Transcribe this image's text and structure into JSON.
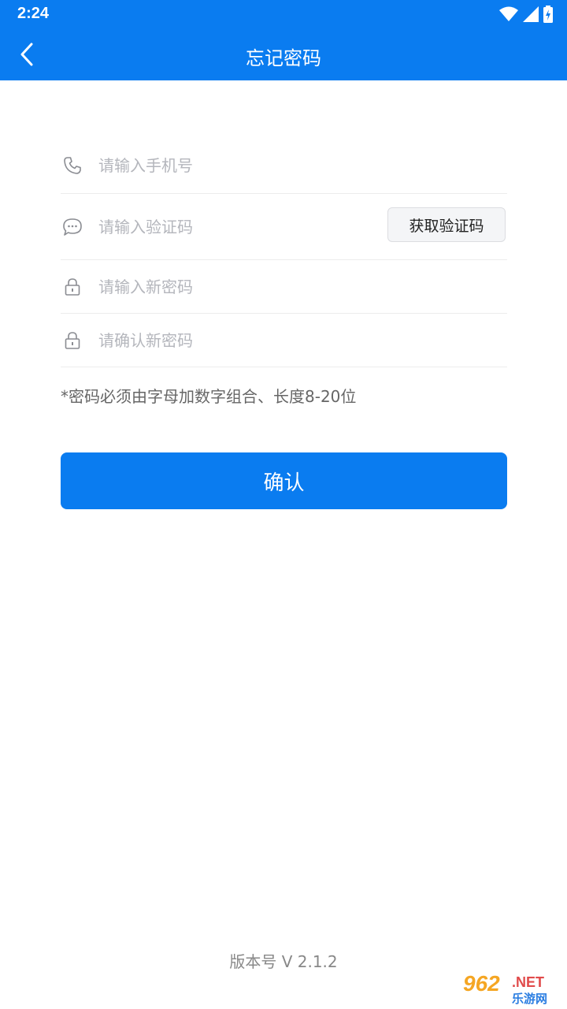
{
  "status_bar": {
    "time": "2:24"
  },
  "header": {
    "title": "忘记密码"
  },
  "form": {
    "phone_placeholder": "请输入手机号",
    "code_placeholder": "请输入验证码",
    "get_code_label": "获取验证码",
    "new_password_placeholder": "请输入新密码",
    "confirm_password_placeholder": "请确认新密码"
  },
  "hint": "*密码必须由字母加数字组合、长度8-20位",
  "confirm_label": "确认",
  "version": "版本号 V 2.1.2",
  "watermark": {
    "brand": "962",
    "net": ".NET",
    "sub": "乐游网"
  },
  "colors": {
    "primary": "#0a7cf0",
    "placeholder": "#b4b6bc"
  },
  "icons": {
    "phone": "phone-icon",
    "message": "message-icon",
    "lock": "lock-icon",
    "back": "chevron-left-icon",
    "wifi": "wifi-icon",
    "signal": "signal-icon",
    "battery": "battery-icon"
  }
}
